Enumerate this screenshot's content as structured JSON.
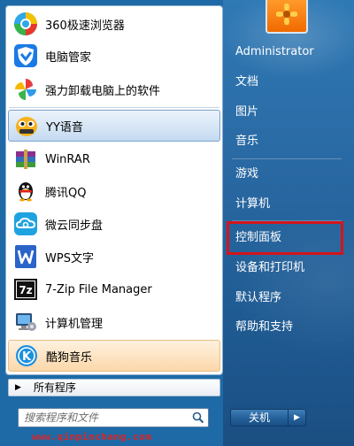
{
  "user": {
    "name": "Administrator"
  },
  "apps": [
    {
      "label": "360极速浏览器",
      "icon": "360-browser-icon"
    },
    {
      "label": "电脑管家",
      "icon": "pc-manager-shield-icon"
    },
    {
      "label": "强力卸载电脑上的软件",
      "icon": "pinwheel-uninstaller-icon"
    },
    {
      "label": "YY语音",
      "icon": "yy-voice-icon"
    },
    {
      "label": "WinRAR",
      "icon": "winrar-books-icon"
    },
    {
      "label": "腾讯QQ",
      "icon": "qq-penguin-icon"
    },
    {
      "label": "微云同步盘",
      "icon": "weiyun-cloud-icon"
    },
    {
      "label": "WPS文字",
      "icon": "wps-writer-icon"
    },
    {
      "label": "7-Zip File Manager",
      "icon": "7zip-icon"
    },
    {
      "label": "计算机管理",
      "icon": "computer-management-icon"
    },
    {
      "label": "酷狗音乐",
      "icon": "kugou-music-icon"
    }
  ],
  "all_programs": "所有程序",
  "search": {
    "placeholder": "搜索程序和文件"
  },
  "right_items": [
    "文档",
    "图片",
    "音乐",
    "游戏",
    "计算机",
    "控制面板",
    "设备和打印机",
    "默认程序",
    "帮助和支持"
  ],
  "shutdown": {
    "label": "关机"
  },
  "watermark": "www.qinpinchang.com",
  "colors": {
    "highlight_box": "#d4141b",
    "hover_blue": "#c4daf1",
    "hover_orange": "#fbd7aa"
  }
}
